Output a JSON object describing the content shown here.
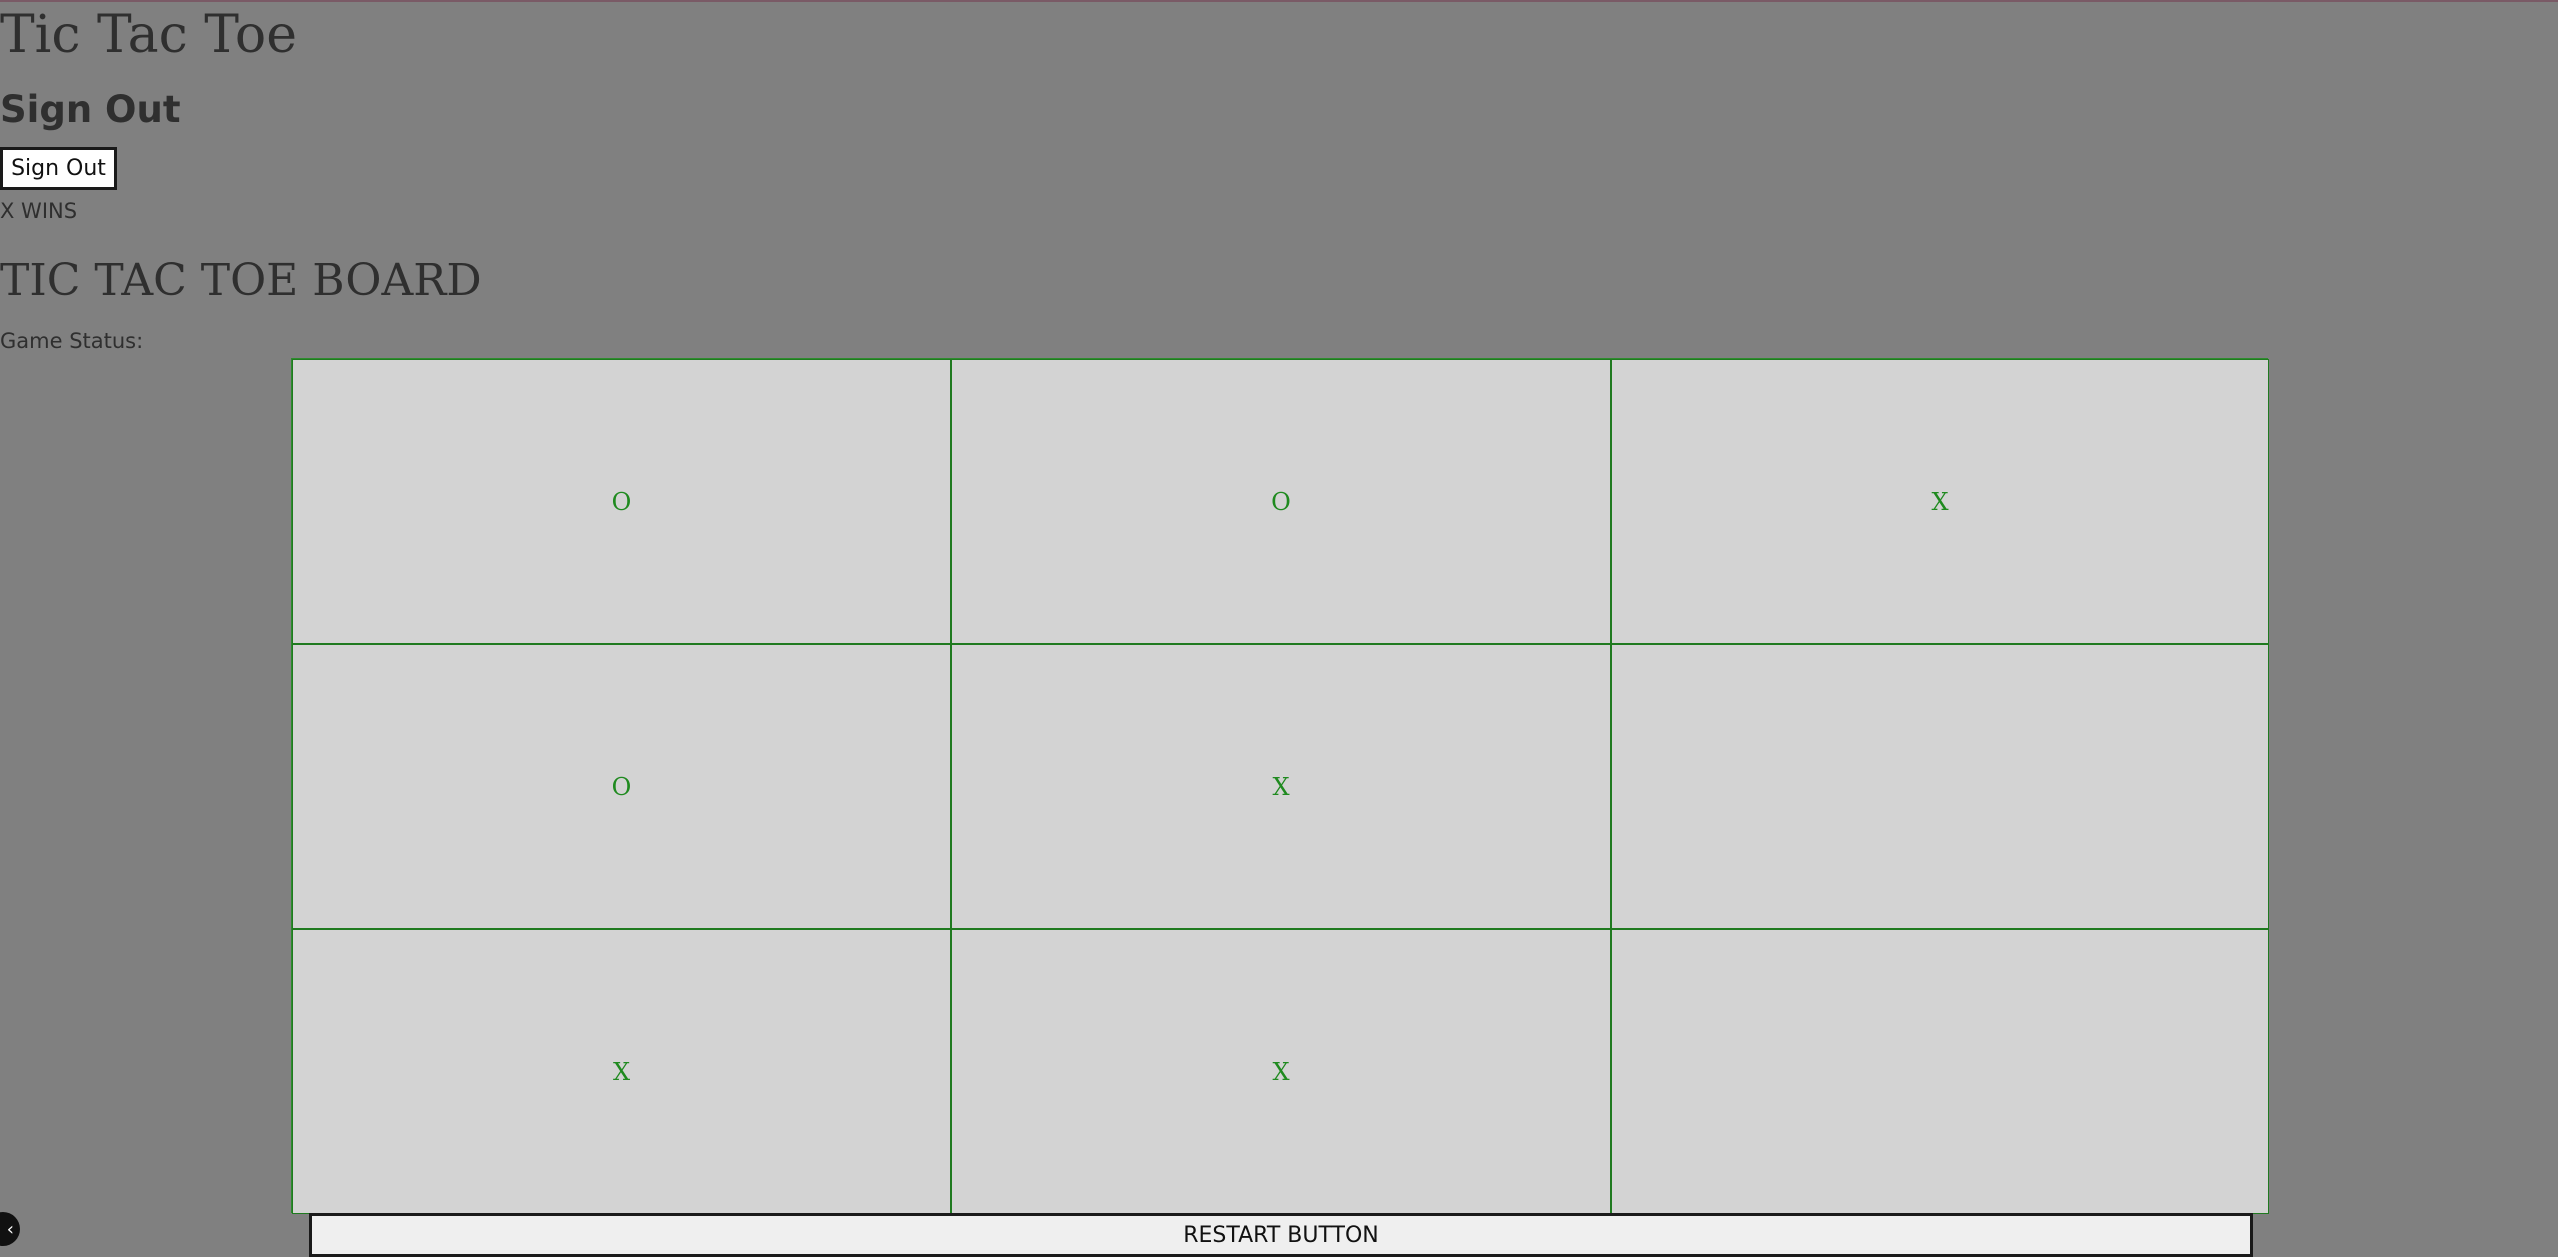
{
  "header": {
    "app_title": "Tic Tac Toe",
    "section_title": "Sign Out",
    "signout_label": "Sign Out",
    "win_message": "X WINS"
  },
  "board": {
    "title": "TIC TAC TOE BOARD",
    "status_label": "Game Status:",
    "cells": [
      "O",
      "O",
      "X",
      "O",
      "X",
      "",
      "X",
      "X",
      ""
    ]
  },
  "footer": {
    "restart_label": "RESTART BUTTON"
  },
  "colors": {
    "page_background": "#808080",
    "cell_background": "#d3d3d3",
    "grid_lines": "#1f7a1f",
    "mark_color": "#1f8a1f"
  },
  "icons": {
    "corner_widget": "chevron-left-icon"
  }
}
